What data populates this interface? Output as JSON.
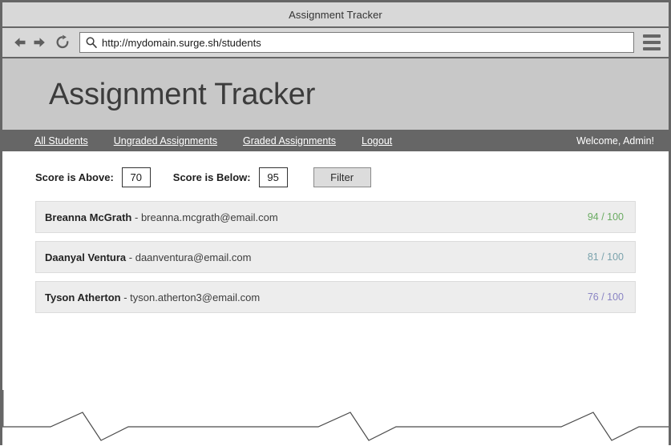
{
  "window": {
    "title": "Assignment Tracker"
  },
  "browser": {
    "back_icon": "back-arrow-icon",
    "forward_icon": "forward-arrow-icon",
    "reload_icon": "reload-icon",
    "search_icon": "search-icon",
    "menu_icon": "hamburger-menu-icon",
    "url": "http://mydomain.surge.sh/students"
  },
  "site": {
    "title": "Assignment Tracker",
    "banner_bg": "#c8c8c8",
    "nav_bg": "#666666",
    "nav_links": [
      {
        "label": "All Students"
      },
      {
        "label": "Ungraded Assignments"
      },
      {
        "label": "Graded Assignments"
      },
      {
        "label": "Logout"
      }
    ],
    "welcome": "Welcome, Admin!"
  },
  "filters": {
    "above_label": "Score is Above:",
    "above_value": "70",
    "below_label": "Score is Below:",
    "below_value": "95",
    "filter_button": "Filter"
  },
  "students": [
    {
      "name": "Breanna McGrath",
      "separator": " - ",
      "email": "breanna.mcgrath@email.com",
      "score": "94 / 100",
      "score_color": "#6aab62"
    },
    {
      "name": "Daanyal Ventura",
      "separator": " - ",
      "email": "daanventura@email.com",
      "score": "81 / 100",
      "score_color": "#7ba3ad"
    },
    {
      "name": "Tyson Atherton",
      "separator": " - ",
      "email": "tyson.atherton3@email.com",
      "score": "76 / 100",
      "score_color": "#8a84c4"
    }
  ]
}
